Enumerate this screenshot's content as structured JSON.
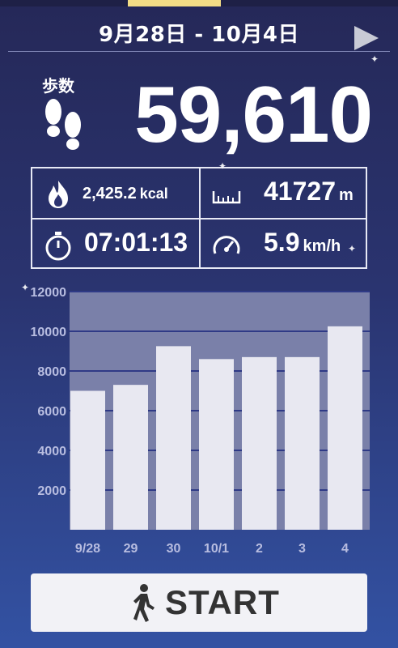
{
  "header": {
    "date_range": "9月28日 - 10月4日"
  },
  "steps": {
    "label": "歩数",
    "value": "59,610"
  },
  "stats": {
    "calories": {
      "value": "2,425.2",
      "unit": "kcal"
    },
    "distance": {
      "value": "41727",
      "unit": "m"
    },
    "time": {
      "value": "07:01:13"
    },
    "speed": {
      "value": "5.9",
      "unit": "km/h"
    }
  },
  "chart_data": {
    "type": "bar",
    "categories": [
      "9/28",
      "29",
      "30",
      "10/1",
      "2",
      "3",
      "4"
    ],
    "values": [
      7000,
      7300,
      9250,
      8600,
      8700,
      8700,
      10250
    ],
    "yticks": [
      2000,
      4000,
      6000,
      8000,
      10000,
      12000
    ],
    "ylim": [
      0,
      12000
    ],
    "title": "",
    "xlabel": "",
    "ylabel": ""
  },
  "start_button": {
    "label": "START"
  },
  "colors": {
    "accent": "#f3dd86",
    "bar": "#e8e8f1",
    "plot_bg": "#7a80a9",
    "gridline": "#2f3a86"
  }
}
